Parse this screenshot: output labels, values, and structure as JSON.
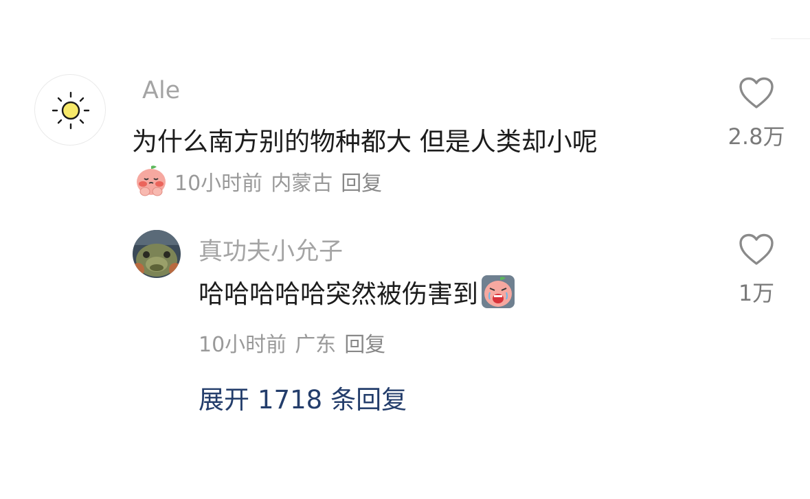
{
  "comment": {
    "username": "Ale",
    "avatar_icon": "sun-icon",
    "text": "为什么南方别的物种都大 但是人类却小呢",
    "badge_icon": "pleading-peach-emoji-icon",
    "time": "10小时前",
    "location": "内蒙古",
    "reply_label": "回复",
    "likes": "2.8万"
  },
  "reply": {
    "username": "真功夫小允子",
    "avatar_icon": "fish-avatar",
    "text": "哈哈哈哈哈突然被伤害到",
    "emoji_icon": "crying-peach-emoji-icon",
    "time": "10小时前",
    "location": "广东",
    "reply_label": "回复",
    "likes": "1万"
  },
  "expand": {
    "label_prefix": "展开",
    "count": "1718",
    "label_suffix": "条回复"
  },
  "colors": {
    "username": "#a4a4a4",
    "text": "#1c1c1c",
    "meta": "#999999",
    "expand_link": "#233d6b",
    "heart_stroke": "#8a8a8a"
  }
}
